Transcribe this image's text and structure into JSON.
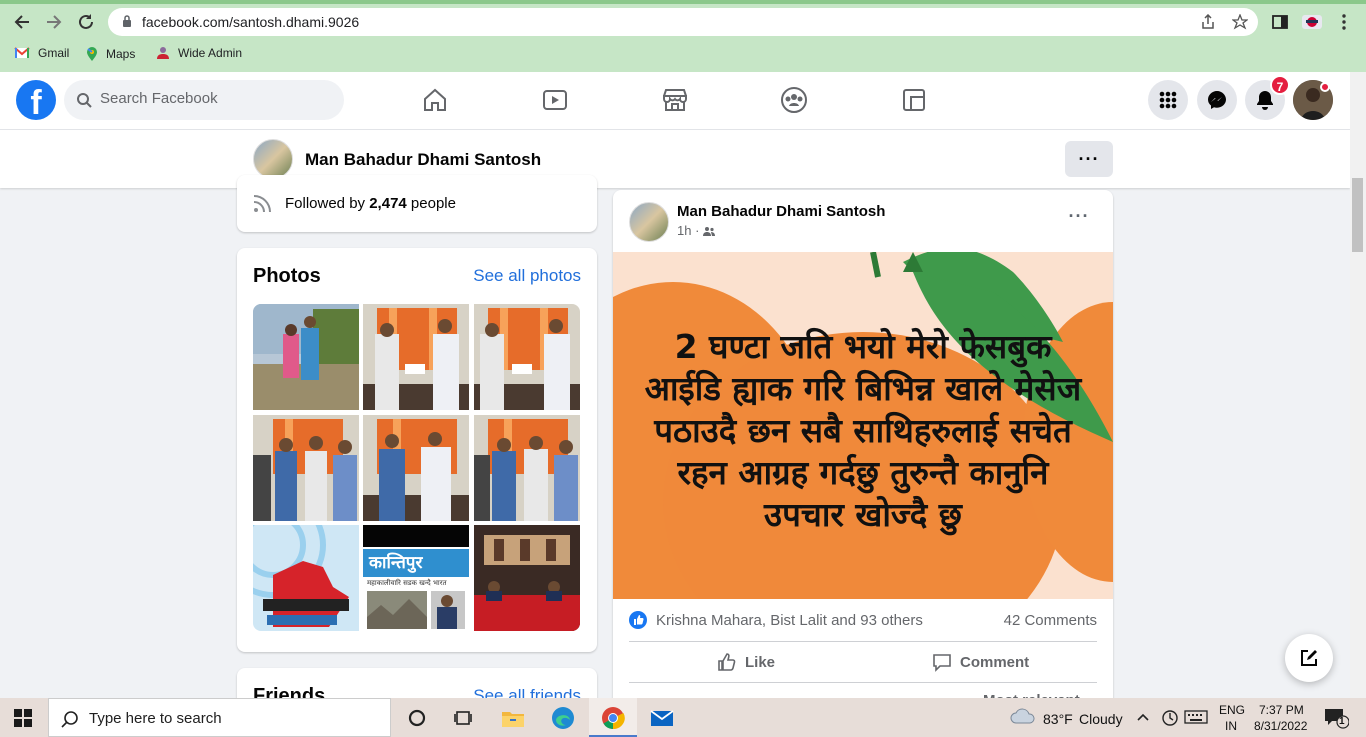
{
  "browser": {
    "url": "facebook.com/santosh.dhami.9026",
    "bookmarks": [
      {
        "label": "Gmail",
        "icon": "gmail-icon"
      },
      {
        "label": "Maps",
        "icon": "maps-icon"
      },
      {
        "label": "Wide Admin",
        "icon": "wide-admin-icon"
      }
    ]
  },
  "fb_header": {
    "logo": "f",
    "search_placeholder": "Search Facebook",
    "notification_count": "7"
  },
  "profile_bar": {
    "name": "Man Bahadur Dhami Santosh",
    "more": "···"
  },
  "intro": {
    "followed_prefix": "Followed by ",
    "followed_count": "2,474",
    "followed_suffix": " people"
  },
  "photos": {
    "title": "Photos",
    "see_all": "See all photos",
    "kantipur_masthead": "कान्तिपुर",
    "kantipur_headline": "महाकालीवारि सडक खन्दै भारत"
  },
  "friends": {
    "title": "Friends",
    "see_all": "See all friends"
  },
  "post": {
    "author": "Man Bahadur Dhami Santosh",
    "time": "1h ·",
    "more": "···",
    "image_text": "2 घण्टा जति भयो मेरो फेसबुक आईडि ह्याक गरि बिभिन्न खाले मेसेज पठाउदै छन सबै साथिहरुलाई सचेत रहन आग्रह गर्दछु तुरुन्तै कानुनि उपचार खोज्दै छु",
    "reactions": "Krishna Mahara, Bist Lalit and 93 others",
    "comments": "42 Comments",
    "like_label": "Like",
    "comment_label": "Comment",
    "sort_label": "Most relevant"
  },
  "taskbar": {
    "search_placeholder": "Type here to search",
    "weather_temp": "83°F",
    "weather_desc": "Cloudy",
    "lang_top": "ENG",
    "lang_bottom": "IN",
    "time": "7:37 PM",
    "date": "8/31/2022",
    "notif_count": "1"
  },
  "colors": {
    "fb_blue": "#1877f2",
    "link_blue": "#216fdb",
    "chrome_green": "#c6e6c6",
    "badge_red": "#e41e3f",
    "post_bg": "#fbe1cf",
    "orange": "#f08a3a"
  }
}
